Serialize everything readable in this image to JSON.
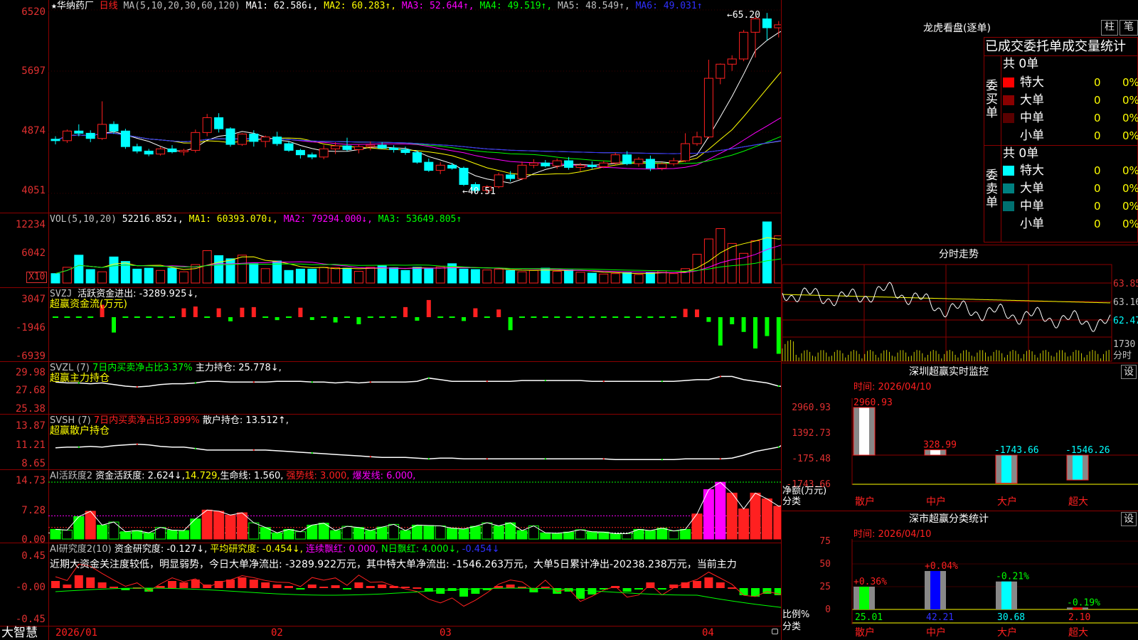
{
  "colors": {
    "up": "#ff2020",
    "down": "#00ffff",
    "ma1": "#ffffff",
    "ma2": "#ffff00",
    "ma3": "#ff00ff",
    "ma4": "#00ff00",
    "ma5": "#c0c0c0",
    "ma6": "#3030ff",
    "grid": "#8b0000",
    "axis": "#e03030"
  },
  "main": {
    "star": "★",
    "stock_name": "华纳药厂",
    "period": "日线",
    "ma_label": "MA(5,10,20,30,60,120)",
    "ma1": "MA1: 62.586↓,",
    "ma2": "MA2: 60.283↑,",
    "ma3": "MA3: 52.644↑,",
    "ma4": "MA4: 49.519↑,",
    "ma5": "MA5: 48.549↑,",
    "ma6": "MA6: 49.031↑",
    "y_labels": [
      "6520",
      "5697",
      "4874",
      "4051"
    ],
    "high_mark": "65.20",
    "low_mark": "40.51",
    "ohlc": [
      [
        47.8,
        48.2,
        47.1,
        47.6
      ],
      [
        47.6,
        49.1,
        47.3,
        48.9
      ],
      [
        48.9,
        49.8,
        48.2,
        48.6
      ],
      [
        48.6,
        49.0,
        47.4,
        47.9
      ],
      [
        47.9,
        52.9,
        47.7,
        49.8
      ],
      [
        49.8,
        50.2,
        48.5,
        48.9
      ],
      [
        48.9,
        49.2,
        46.5,
        46.8
      ],
      [
        46.8,
        47.2,
        45.9,
        46.2
      ],
      [
        46.2,
        46.5,
        45.5,
        45.8
      ],
      [
        45.8,
        46.8,
        45.6,
        46.5
      ],
      [
        46.5,
        47.0,
        45.9,
        46.1
      ],
      [
        46.1,
        46.5,
        45.6,
        46.3
      ],
      [
        46.3,
        49.1,
        46.0,
        48.7
      ],
      [
        48.7,
        51.2,
        48.2,
        50.7
      ],
      [
        50.7,
        51.3,
        48.7,
        49.2
      ],
      [
        49.2,
        49.4,
        46.8,
        47.1
      ],
      [
        47.1,
        48.6,
        46.9,
        48.5
      ],
      [
        48.5,
        49.0,
        46.8,
        47.5
      ],
      [
        47.5,
        48.3,
        46.7,
        48.1
      ],
      [
        48.1,
        48.8,
        46.9,
        47.2
      ],
      [
        47.2,
        47.5,
        46.1,
        46.3
      ],
      [
        46.3,
        46.5,
        45.2,
        45.7
      ],
      [
        45.7,
        46.0,
        45.1,
        45.4
      ],
      [
        45.4,
        47.0,
        45.1,
        46.5
      ],
      [
        46.5,
        47.4,
        45.8,
        46.9
      ],
      [
        46.9,
        48.0,
        46.2,
        46.4
      ],
      [
        46.4,
        47.1,
        45.9,
        46.8
      ],
      [
        46.8,
        47.5,
        46.3,
        47.0
      ],
      [
        47.0,
        47.4,
        46.5,
        46.6
      ],
      [
        46.6,
        47.0,
        46.0,
        46.4
      ],
      [
        46.4,
        46.8,
        45.7,
        46.0
      ],
      [
        46.0,
        46.3,
        44.5,
        44.7
      ],
      [
        44.7,
        45.2,
        43.4,
        43.6
      ],
      [
        43.6,
        44.7,
        43.1,
        44.3
      ],
      [
        44.3,
        44.6,
        43.7,
        43.9
      ],
      [
        43.9,
        44.1,
        41.5,
        41.7
      ],
      [
        41.7,
        42.0,
        40.6,
        40.9
      ],
      [
        40.9,
        41.6,
        40.5,
        41.4
      ],
      [
        41.4,
        43.3,
        41.2,
        43.0
      ],
      [
        43.0,
        43.5,
        42.1,
        42.5
      ],
      [
        42.5,
        44.8,
        42.3,
        44.3
      ],
      [
        44.3,
        45.1,
        43.9,
        44.6
      ],
      [
        44.6,
        45.0,
        44.0,
        44.2
      ],
      [
        44.2,
        45.2,
        43.8,
        44.9
      ],
      [
        44.9,
        45.4,
        43.7,
        44.0
      ],
      [
        44.0,
        44.6,
        43.5,
        44.3
      ],
      [
        44.3,
        44.8,
        43.8,
        44.1
      ],
      [
        44.1,
        44.9,
        43.9,
        44.6
      ],
      [
        44.6,
        46.0,
        44.4,
        45.7
      ],
      [
        45.7,
        46.2,
        44.3,
        44.5
      ],
      [
        44.5,
        45.4,
        44.1,
        45.1
      ],
      [
        45.1,
        45.6,
        43.5,
        43.9
      ],
      [
        43.9,
        44.7,
        43.6,
        44.5
      ],
      [
        44.5,
        45.3,
        44.2,
        44.9
      ],
      [
        44.9,
        48.6,
        44.7,
        47.2
      ],
      [
        47.2,
        48.8,
        46.9,
        48.1
      ],
      [
        48.1,
        58.5,
        47.9,
        56.0
      ],
      [
        56.0,
        58.0,
        55.2,
        57.9
      ],
      [
        57.9,
        59.1,
        57.0,
        58.6
      ],
      [
        58.6,
        62.5,
        58.3,
        62.2
      ],
      [
        62.2,
        64.3,
        58.8,
        64.0
      ],
      [
        64.0,
        64.8,
        61.1,
        62.8
      ],
      [
        62.8,
        63.7,
        61.5,
        63.2
      ],
      [
        63.2,
        64.0,
        60.6,
        62.1
      ],
      [
        62.1,
        64.3,
        61.7,
        63.3
      ],
      [
        63.3,
        63.9,
        62.0,
        62.6
      ],
      [
        62.6,
        65.2,
        61.5,
        61.9
      ]
    ]
  },
  "vol": {
    "label": "VOL(5,10,20)",
    "v": "52216.852↓,",
    "ma1": "MA1: 60393.070↓,",
    "ma2": "MA2: 79294.000↓,",
    "ma3": "MA3: 53649.805↑",
    "y_labels": [
      "12234",
      "6042"
    ],
    "x10": "X10",
    "values": [
      2.1,
      3.5,
      6.2,
      3.0,
      2.5,
      5.8,
      4.8,
      3.1,
      3.3,
      2.8,
      3.3,
      2.5,
      4.1,
      7.2,
      6.1,
      5.4,
      6.2,
      4.3,
      3.2,
      4.9,
      2.8,
      3.1,
      3.1,
      3.5,
      3.4,
      3.3,
      2.6,
      3.5,
      3.8,
      3.4,
      2.8,
      3.5,
      3.2,
      3.6,
      4.3,
      3.1,
      3.0,
      2.9,
      3.1,
      2.8,
      2.5,
      2.8,
      3.3,
      2.6,
      2.9,
      2.4,
      2.2,
      2.0,
      2.1,
      2.3,
      1.9,
      2.4,
      2.7,
      2.1,
      3.2,
      6.4,
      9.8,
      12.1,
      8.8,
      6.6,
      9.4,
      13.6,
      10.5,
      10.2,
      9.3,
      7.0,
      5.2
    ]
  },
  "svzj": {
    "name": "SVZJ",
    "text1": "活跃资金进出: -3289.925↓,",
    "text2": "超赢资金流(万元)",
    "y_labels": [
      "3047",
      "-1946",
      "-6939"
    ],
    "values": [
      -300,
      -320,
      -280,
      -350,
      2100,
      -2600,
      -300,
      -280,
      -320,
      -310,
      -300,
      1500,
      1800,
      -320,
      1500,
      -700,
      1600,
      1700,
      -300,
      -500,
      -310,
      1600,
      -480,
      -300,
      -900,
      -320,
      -1200,
      -300,
      -330,
      -300,
      1700,
      -600,
      2900,
      -300,
      -350,
      -650,
      1500,
      -360,
      1300,
      -2200,
      -300,
      -320,
      -350,
      -300,
      -290,
      -300,
      -280,
      -310,
      -330,
      -300,
      -310,
      -300,
      -330,
      -320,
      1400,
      1300,
      -800,
      -4800,
      -1200,
      -2500,
      -5300,
      -3200,
      -6200,
      -4700,
      -2100,
      -1000,
      -3300
    ]
  },
  "svzl": {
    "name": "SVZL",
    "param": "(7)",
    "text1": "7日内买卖净占比3.37%",
    "text2": "主力持仓: 25.778↓,",
    "text3": "超赢主力持仓",
    "y_labels": [
      "29.98",
      "27.68",
      "25.38"
    ],
    "values": [
      28.8,
      28.7,
      28.7,
      28.6,
      28.7,
      28.5,
      28.3,
      28.2,
      28.3,
      28.5,
      28.6,
      28.6,
      28.7,
      28.9,
      28.9,
      28.8,
      28.8,
      28.8,
      28.8,
      28.9,
      28.9,
      28.9,
      28.8,
      28.8,
      28.7,
      28.8,
      28.7,
      28.8,
      28.8,
      28.8,
      28.8,
      28.9,
      29.3,
      29.1,
      28.9,
      28.9,
      28.9,
      28.9,
      28.9,
      28.9,
      29.0,
      29.0,
      29.0,
      29.0,
      29.0,
      29.0,
      28.9,
      28.9,
      28.9,
      28.9,
      28.9,
      28.9,
      28.9,
      28.9,
      29.0,
      29.1,
      29.1,
      29.5,
      29.5,
      29.1,
      28.9,
      28.7,
      28.3,
      28.2,
      27.8,
      27.5,
      27.2,
      26.8,
      26.5,
      26.2,
      26.0,
      25.8
    ]
  },
  "svsh": {
    "name": "SVSH",
    "param": "(7)",
    "text1": "7日内买卖净占比3.899%",
    "text2": "散户持仓: 13.512↑,",
    "text3": "超赢散户持仓",
    "y_labels": [
      "13.87",
      "11.21",
      "8.65"
    ],
    "values": [
      10.8,
      10.9,
      10.9,
      11.0,
      10.9,
      11.1,
      11.2,
      11.3,
      11.2,
      11.0,
      10.9,
      10.9,
      10.7,
      10.5,
      10.5,
      10.5,
      10.5,
      10.5,
      10.5,
      10.4,
      10.3,
      10.2,
      10.1,
      10.0,
      9.9,
      9.8,
      9.7,
      9.6,
      9.5,
      9.5,
      9.5,
      9.4,
      9.3,
      9.4,
      9.4,
      9.3,
      9.3,
      9.3,
      9.3,
      9.3,
      9.3,
      9.3,
      9.3,
      9.3,
      9.3,
      9.3,
      9.3,
      9.3,
      9.2,
      9.2,
      9.2,
      9.2,
      9.2,
      9.2,
      9.3,
      9.3,
      9.3,
      9.3,
      9.4,
      9.8,
      10.3,
      10.6,
      10.9,
      11.8,
      12.5,
      12.9,
      13.5
    ]
  },
  "ai1": {
    "name": "AI活跃度2",
    "text1": "资金活跃度: 2.624↓,",
    "text2": "14.729,",
    "text3": "生命线: 1.560,",
    "text4": "强势线: 3.000,",
    "text5": "爆发线: 6.000,",
    "y_labels": [
      "14.73",
      "7.28",
      "0.00"
    ],
    "values": [
      2.5,
      2.3,
      5.8,
      7.2,
      3.6,
      4.4,
      1.9,
      2.2,
      1.6,
      3.0,
      2.3,
      2.2,
      5.2,
      7.5,
      7.2,
      6.2,
      6.8,
      4.2,
      3.0,
      1.6,
      2.5,
      1.9,
      3.6,
      4.1,
      2.2,
      3.3,
      3.0,
      2.2,
      3.1,
      3.8,
      2.2,
      3.6,
      3.5,
      3.4,
      2.8,
      2.6,
      3.3,
      4.2,
      3.4,
      4.2,
      2.2,
      3.4,
      1.6,
      1.5,
      1.8,
      2.4,
      1.9,
      1.8,
      1.4,
      1.4,
      2.5,
      2.2,
      2.8,
      2.1,
      2.5,
      6.5,
      12.8,
      14.7,
      11.9,
      7.8,
      11.9,
      10.4,
      8.5,
      9.0,
      5.6,
      4.6,
      4.0,
      3.5
    ]
  },
  "ai2": {
    "name": "AI研究度2(10)",
    "text1": "资金研究度: -0.127↓,",
    "text2": "平均研究度: -0.454↓,",
    "text3": "连续飘红: 0.000,",
    "text4": "N日飘红: 4.000↓,",
    "text5": "-0.454↓",
    "comment": "近期大资金关注度较低，明显弱势，今日大单净流出: -3289.922万元，其中特大单净流出: -1546.263万元，大单5日累计净出-20238.238万元，当前主力",
    "y_labels": [
      "0.45",
      "-0.00",
      "-0.45"
    ],
    "values": [
      0.1,
      0.05,
      0.18,
      0.15,
      0.08,
      0.02,
      -0.03,
      0.01,
      -0.05,
      0.03,
      0.1,
      0.08,
      0.12,
      0.05,
      0.1,
      0.12,
      0.15,
      0.12,
      0.08,
      0.05,
      0.03,
      -0.02,
      0.05,
      0.02,
      0.04,
      -0.02,
      0.08,
      0.03,
      0.05,
      0.03,
      0.02,
      0.01,
      -0.05,
      -0.08,
      -0.04,
      -0.12,
      -0.08,
      -0.03,
      0.03,
      0.05,
      0.02,
      -0.06,
      0.02,
      -0.08,
      -0.05,
      -0.15,
      -0.09,
      -0.02,
      0.03,
      -0.05,
      -0.02,
      0.08,
      -0.01,
      0.05,
      0.08,
      0.1,
      0.15,
      0.08,
      0.01,
      -0.1,
      -0.12,
      -0.08,
      -0.1,
      -0.12,
      -0.1,
      -0.13
    ]
  },
  "xaxis": {
    "brand": "大智慧",
    "labels": [
      "2026/01",
      "02",
      "03",
      "04"
    ]
  },
  "lhb": {
    "title": "龙虎看盘(逐单)",
    "btn1": "柱",
    "btn2": "笔",
    "header": "已成交委托单成交量统计",
    "buy_label": "委买单",
    "sell_label": "委卖单",
    "total": "共 0单",
    "rows": [
      {
        "name": "特大",
        "v": "0",
        "p": "0%"
      },
      {
        "name": "大单",
        "v": "0",
        "p": "0%"
      },
      {
        "name": "中单",
        "v": "0",
        "p": "0%"
      },
      {
        "name": "小单",
        "v": "0",
        "p": "0%"
      }
    ],
    "buy_colors": [
      "#ff0000",
      "#8b0000",
      "#5a0000",
      "#000000"
    ],
    "sell_colors": [
      "#00ffff",
      "#008080",
      "#007070",
      "#000000"
    ]
  },
  "fs": {
    "title": "分时走势",
    "y_labels": [
      "63.85",
      "63.16",
      "62.47"
    ],
    "vol_label": "1730",
    "unit": "分时"
  },
  "sz": {
    "title": "深圳超赢实时监控",
    "btn": "设",
    "time": "时间: 2026/04/10",
    "y_labels": [
      "2960.93",
      "1392.73",
      "-175.48",
      "-1743.66"
    ],
    "ylab": "净额(万元)",
    "ylab2": "分类",
    "bars": [
      {
        "cat": "散户",
        "val": "2960.93",
        "v": 2960.93,
        "color": "#ffffff"
      },
      {
        "cat": "中户",
        "val": "328.99",
        "v": 328.99,
        "color": "#ffffff"
      },
      {
        "cat": "大户",
        "val": "-1743.66",
        "v": -1743.66,
        "color": "#00ffff"
      },
      {
        "cat": "超大",
        "val": "-1546.26",
        "v": -1546.26,
        "color": "#00ffff"
      }
    ]
  },
  "sc": {
    "title": "深市超赢分类统计",
    "btn": "设",
    "time": "时间: 2026/04/10",
    "y_labels": [
      "75",
      "50",
      "25",
      "0"
    ],
    "ylab": "比例%",
    "ylab2": "分类",
    "bars": [
      {
        "cat": "散户",
        "val": "25.01",
        "top": "+0.36%",
        "v": 25.01,
        "color": "#00ff00"
      },
      {
        "cat": "中户",
        "val": "42.21",
        "top": "+0.04%",
        "v": 42.21,
        "color": "#0000ff"
      },
      {
        "cat": "大户",
        "val": "30.68",
        "top": "-0.21%",
        "v": 30.68,
        "color": "#00ffff"
      },
      {
        "cat": "超大",
        "val": "2.10",
        "top": "-0.19%",
        "v": 2.1,
        "color": "#ff0000"
      }
    ]
  }
}
